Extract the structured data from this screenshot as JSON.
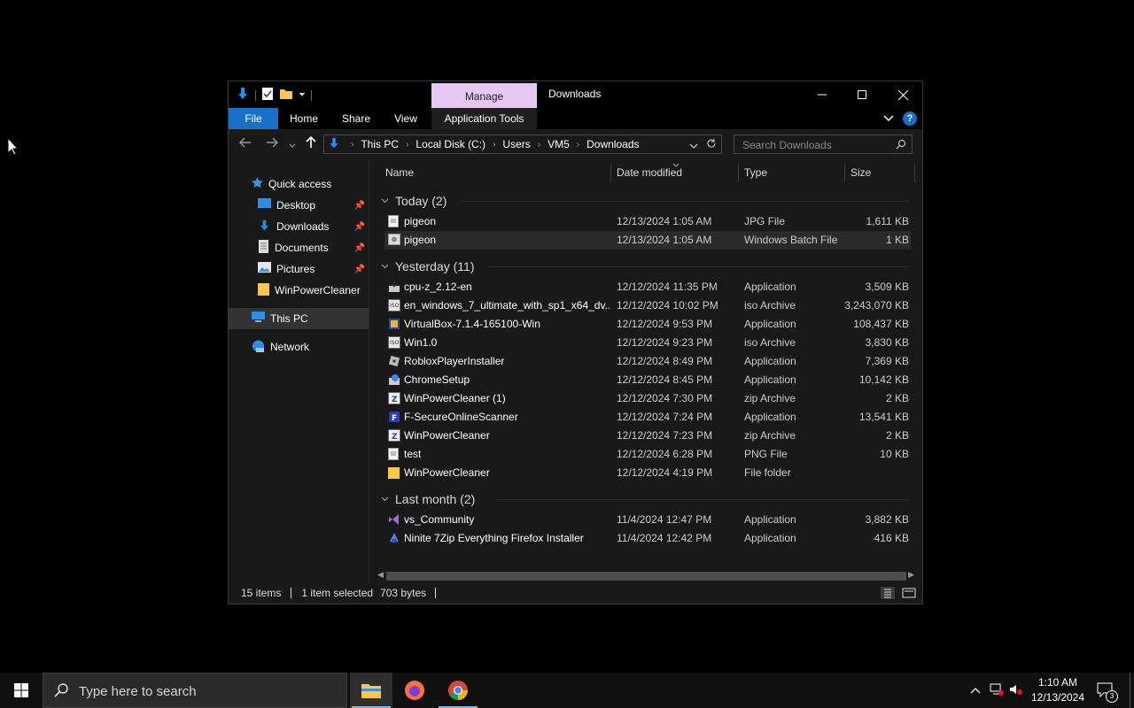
{
  "window": {
    "title": "Downloads",
    "manage_tab": "Manage",
    "ribbon_tabs": [
      "File",
      "Home",
      "Share",
      "View",
      "Application Tools"
    ],
    "controls": {
      "minimize": "—",
      "maximize": "☐",
      "close": "✕"
    }
  },
  "address": {
    "crumbs": [
      "This PC",
      "Local Disk (C:)",
      "Users",
      "VM5",
      "Downloads"
    ],
    "search_placeholder": "Search Downloads"
  },
  "nav_pane": {
    "quick_access": "Quick access",
    "pinned": [
      {
        "label": "Desktop",
        "icon": "desktop-icon",
        "pinned": true
      },
      {
        "label": "Downloads",
        "icon": "download-arrow-icon",
        "pinned": true
      },
      {
        "label": "Documents",
        "icon": "documents-icon",
        "pinned": true
      },
      {
        "label": "Pictures",
        "icon": "pictures-icon",
        "pinned": true
      },
      {
        "label": "WinPowerCleaner",
        "icon": "folder-icon",
        "pinned": false
      }
    ],
    "this_pc": "This PC",
    "network": "Network"
  },
  "columns": {
    "name": "Name",
    "date": "Date modified",
    "type": "Type",
    "size": "Size"
  },
  "groups": [
    {
      "title": "Today (2)",
      "files": [
        {
          "name": "pigeon",
          "date": "12/13/2024 1:05 AM",
          "type": "JPG File",
          "size": "1,611 KB",
          "icon": "image-file-icon"
        },
        {
          "name": "pigeon",
          "date": "12/13/2024 1:05 AM",
          "type": "Windows Batch File",
          "size": "1 KB",
          "icon": "batch-file-icon",
          "selected": true
        }
      ]
    },
    {
      "title": "Yesterday (11)",
      "files": [
        {
          "name": "cpu-z_2.12-en",
          "date": "12/12/2024 11:35 PM",
          "type": "Application",
          "size": "3,509 KB",
          "icon": "installer-icon"
        },
        {
          "name": "en_windows_7_ultimate_with_sp1_x64_dv...",
          "date": "12/12/2024 10:02 PM",
          "type": "iso Archive",
          "size": "3,243,070 KB",
          "icon": "iso-archive-icon"
        },
        {
          "name": "VirtualBox-7.1.4-165100-Win",
          "date": "12/12/2024 9:53 PM",
          "type": "Application",
          "size": "108,437 KB",
          "icon": "virtualbox-icon"
        },
        {
          "name": "Win1.0",
          "date": "12/12/2024 9:23 PM",
          "type": "iso Archive",
          "size": "3,830 KB",
          "icon": "iso-archive-icon"
        },
        {
          "name": "RobloxPlayerInstaller",
          "date": "12/12/2024 8:49 PM",
          "type": "Application",
          "size": "7,369 KB",
          "icon": "roblox-icon"
        },
        {
          "name": "ChromeSetup",
          "date": "12/12/2024 8:45 PM",
          "type": "Application",
          "size": "10,142 KB",
          "icon": "chrome-setup-icon"
        },
        {
          "name": "WinPowerCleaner (1)",
          "date": "12/12/2024 7:30 PM",
          "type": "zip Archive",
          "size": "2 KB",
          "icon": "zip-archive-icon"
        },
        {
          "name": "F-SecureOnlineScanner",
          "date": "12/12/2024 7:24 PM",
          "type": "Application",
          "size": "13,541 KB",
          "icon": "fsecure-icon"
        },
        {
          "name": "WinPowerCleaner",
          "date": "12/12/2024 7:23 PM",
          "type": "zip Archive",
          "size": "2 KB",
          "icon": "zip-archive-icon"
        },
        {
          "name": "test",
          "date": "12/12/2024 6:28 PM",
          "type": "PNG File",
          "size": "10 KB",
          "icon": "image-file-icon"
        },
        {
          "name": "WinPowerCleaner",
          "date": "12/12/2024 4:19 PM",
          "type": "File folder",
          "size": "",
          "icon": "folder-icon"
        }
      ]
    },
    {
      "title": "Last month (2)",
      "files": [
        {
          "name": "vs_Community",
          "date": "11/4/2024 12:47 PM",
          "type": "Application",
          "size": "3,882 KB",
          "icon": "visual-studio-icon"
        },
        {
          "name": "Ninite 7Zip Everything Firefox Installer",
          "date": "11/4/2024 12:42 PM",
          "type": "Application",
          "size": "416 KB",
          "icon": "ninite-icon"
        }
      ]
    }
  ],
  "status": {
    "items": "15 items",
    "selected": "1 item selected",
    "size": "703 bytes"
  },
  "taskbar": {
    "search_placeholder": "Type here to search",
    "time": "1:10 AM",
    "date": "12/13/2024",
    "notifications": "3"
  },
  "colors": {
    "file_tab": "#1a6fc6",
    "manage_tab": "#e5c8f2",
    "window_bg": "#191919",
    "taskbar_bg": "#101010"
  }
}
